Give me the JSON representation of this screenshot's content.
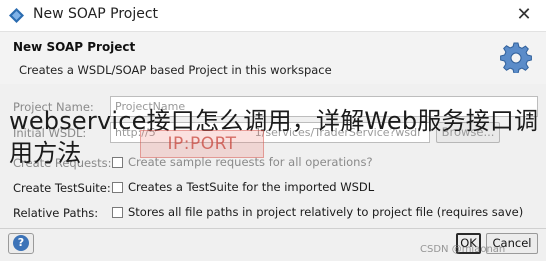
{
  "window": {
    "title": "New SOAP Project",
    "close_label": "✕"
  },
  "banner": {
    "title": "New SOAP Project",
    "description": "Creates a WSDL/SOAP based Project in this workspace"
  },
  "form": {
    "project_name_label": "Project Name:",
    "project_name_value": "ProjectName",
    "initial_wsdl_label": "Initial WSDL:",
    "initial_wsdl_value_left": "http://5",
    "initial_wsdl_value_right": "1/services/TraderService?wsdl",
    "browse_label": "Browse...",
    "create_requests_label": "Create Requests:",
    "create_requests_option": "Create sample requests for all operations?",
    "create_testsuite_label": "Create TestSuite:",
    "create_testsuite_option": "Creates a TestSuite for the imported WSDL",
    "relative_paths_label": "Relative Paths:",
    "relative_paths_option": "Stores all file paths in project relatively to project file (requires save)"
  },
  "overlay": {
    "headline": "webservice接口怎么调用，详解Web服务接口调用方法",
    "ip_badge": "IP:PORT"
  },
  "footer": {
    "help_icon_text": "?",
    "ok_label": "OK",
    "cancel_label": "Cancel",
    "credit": "CSDN @miaonan"
  }
}
